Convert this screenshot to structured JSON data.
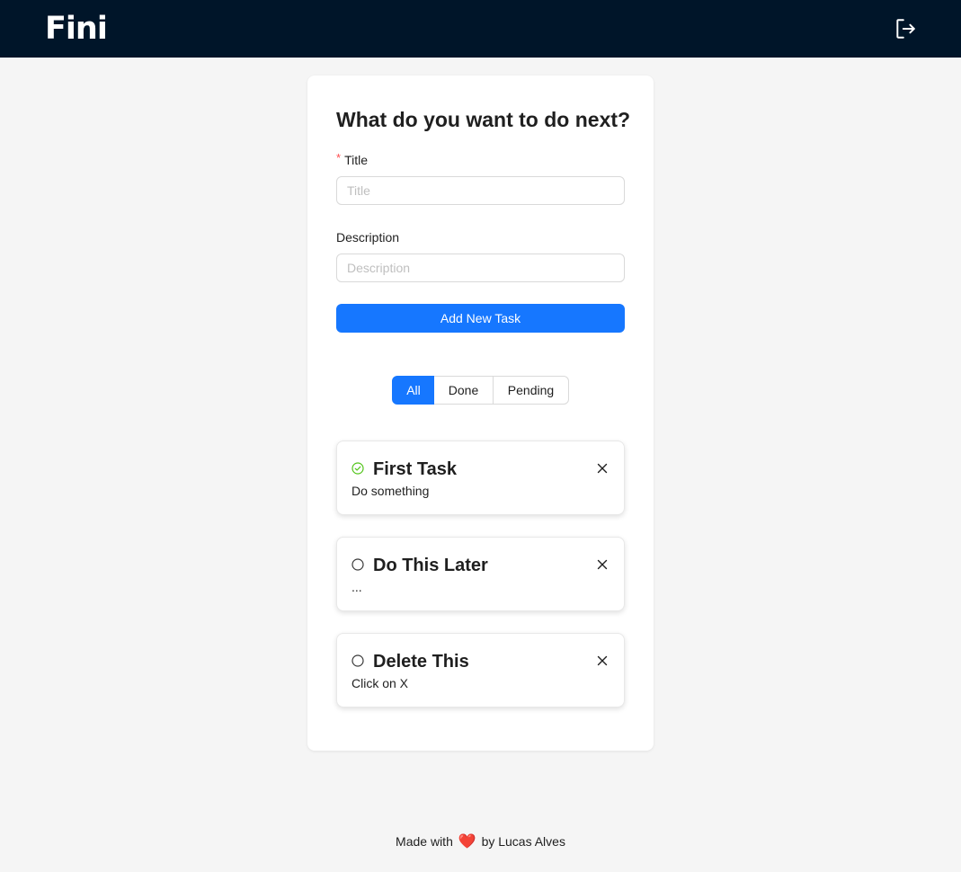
{
  "header": {
    "logo": "Fini",
    "logout_icon": "logout-icon"
  },
  "form": {
    "heading": "What do you want to do next?",
    "title_label": "Title",
    "title_required_mark": "*",
    "title_placeholder": "Title",
    "title_value": "",
    "description_label": "Description",
    "description_placeholder": "Description",
    "description_value": "",
    "submit_label": "Add New Task"
  },
  "filter": {
    "options": [
      "All",
      "Done",
      "Pending"
    ],
    "selected": "All"
  },
  "tasks": [
    {
      "title": "First Task",
      "description": "Do something",
      "done": true,
      "status_icon": "check-circle-icon",
      "close_icon": "close-icon"
    },
    {
      "title": "Do This Later",
      "description": "...",
      "done": false,
      "status_icon": "circle-icon",
      "close_icon": "close-icon"
    },
    {
      "title": "Delete This",
      "description": "Click on X",
      "done": false,
      "status_icon": "circle-icon",
      "close_icon": "close-icon"
    }
  ],
  "footer": {
    "prefix": "Made with",
    "heart": "❤️",
    "suffix": "by Lucas Alves"
  },
  "colors": {
    "header_bg": "#001529",
    "primary": "#1677ff",
    "done_green": "#52c41a",
    "required_red": "#ff4d4f"
  }
}
